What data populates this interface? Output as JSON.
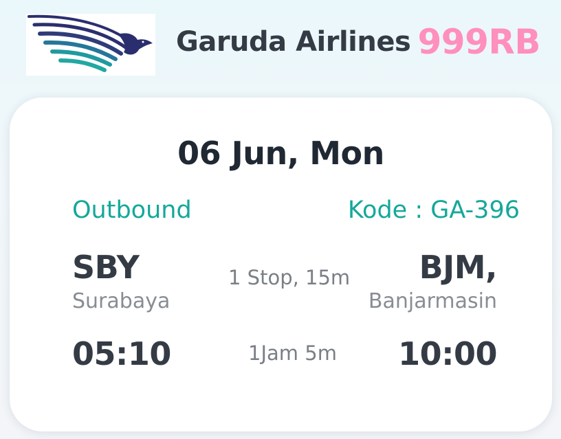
{
  "header": {
    "airline_name": "Garuda Airlines",
    "price": "999RB",
    "logo_icon": "garuda-bird-logo"
  },
  "flight": {
    "date": "06 Jun, Mon",
    "direction": "Outbound",
    "code_label": "Kode : GA-396",
    "origin": {
      "code": "SBY",
      "city": "Surabaya"
    },
    "destination": {
      "code": "BJM,",
      "city": "Banjarmasin"
    },
    "stops": "1 Stop, 15m",
    "departure_time": "05:10",
    "arrival_time": "10:00",
    "duration": "1Jam 5m"
  },
  "colors": {
    "accent_teal": "#14a89a",
    "price_pink": "#ff8fbd",
    "logo_navy": "#2b2e6e",
    "logo_teal": "#1f9b9e"
  }
}
